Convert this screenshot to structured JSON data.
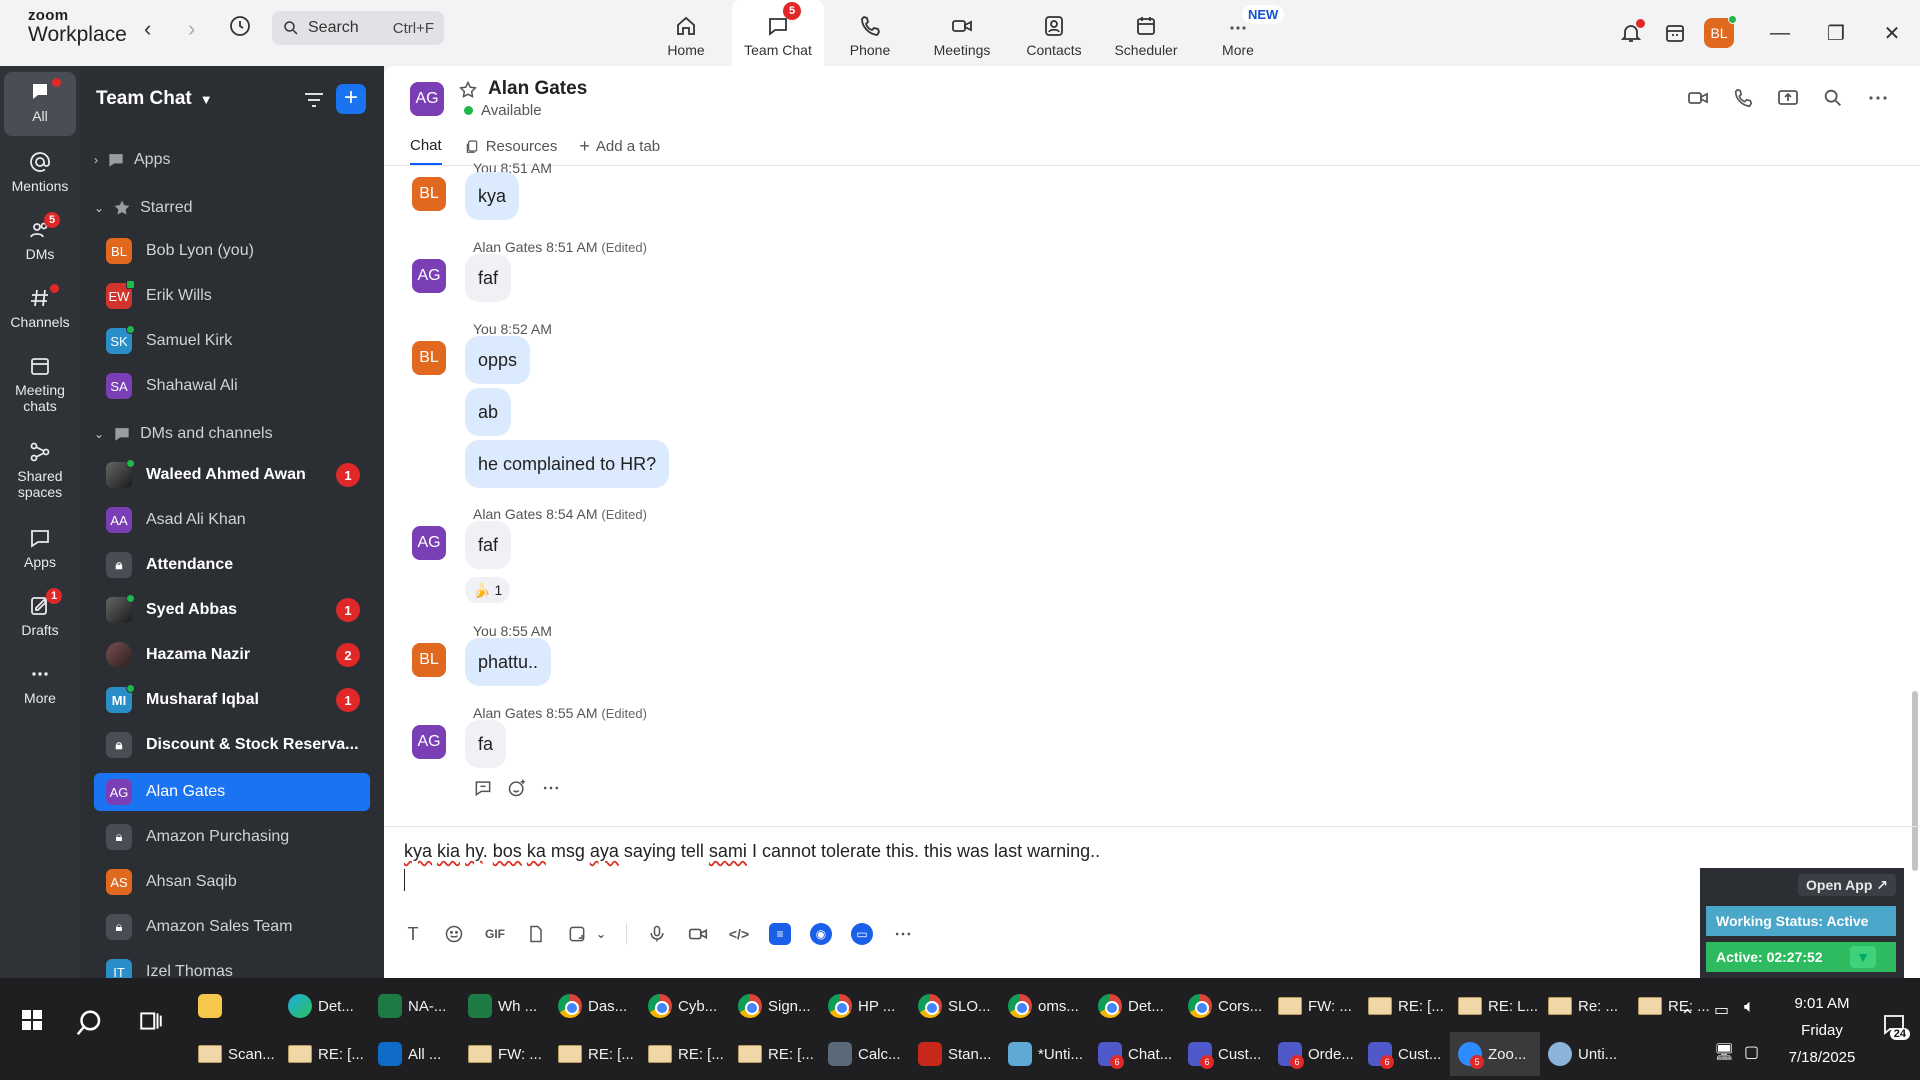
{
  "app": {
    "logo_line1": "zoom",
    "logo_line2": "Workplace",
    "search_placeholder": "Search",
    "search_shortcut": "Ctrl+F",
    "accent_color": "#0b5cff",
    "user_initials": "BL"
  },
  "topnav": {
    "items": [
      {
        "label": "Home",
        "icon": "home-icon"
      },
      {
        "label": "Team Chat",
        "icon": "chat-icon",
        "badge": "5",
        "active": true
      },
      {
        "label": "Phone",
        "icon": "phone-icon"
      },
      {
        "label": "Meetings",
        "icon": "video-icon"
      },
      {
        "label": "Contacts",
        "icon": "contacts-icon"
      },
      {
        "label": "Scheduler",
        "icon": "calendar-icon"
      },
      {
        "label": "More",
        "icon": "more-icon",
        "tag": "NEW"
      }
    ]
  },
  "rail": {
    "items": [
      {
        "label": "All"
      },
      {
        "label": "Mentions"
      },
      {
        "label": "DMs",
        "badge": "5"
      },
      {
        "label": "Channels"
      },
      {
        "label": "Meeting chats"
      },
      {
        "label": "Shared spaces"
      },
      {
        "label": "Apps"
      },
      {
        "label": "Drafts",
        "badge": "1"
      },
      {
        "label": "More"
      }
    ]
  },
  "sidebar": {
    "title": "Team Chat",
    "sections": {
      "apps": "Apps",
      "starred": "Starred",
      "dms": "DMs and channels"
    },
    "starred": [
      {
        "initials": "BL",
        "name": "Bob Lyon (you)",
        "color": "#e0691f"
      },
      {
        "initials": "EW",
        "name": "Erik Wills",
        "color": "#d0342c"
      },
      {
        "initials": "SK",
        "name": "Samuel Kirk",
        "color": "#2a8fc9"
      },
      {
        "initials": "SA",
        "name": "Shahawal Ali",
        "color": "#7b3fb5"
      }
    ],
    "channels": [
      {
        "initials": "",
        "name": "Waleed Ahmed Awan",
        "count": "1"
      },
      {
        "initials": "AA",
        "name": "Asad Ali Khan",
        "color": "#7b3fb5"
      },
      {
        "initials": "",
        "name": "Attendance"
      },
      {
        "initials": "",
        "name": "Syed Abbas",
        "count": "1"
      },
      {
        "initials": "",
        "name": "Hazama Nazir",
        "count": "2"
      },
      {
        "initials": "MI",
        "name": "Musharaf Iqbal",
        "count": "1",
        "color": "#2a8fc9"
      },
      {
        "initials": "",
        "name": "Discount & Stock Reserva..."
      },
      {
        "initials": "AG",
        "name": "Alan Gates",
        "color": "#7b3fb5"
      },
      {
        "initials": "",
        "name": "Amazon Purchasing"
      },
      {
        "initials": "AS",
        "name": "Ahsan Saqib",
        "color": "#e0691f"
      },
      {
        "initials": "",
        "name": "Amazon Sales Team"
      },
      {
        "initials": "IT",
        "name": "Izel Thomas",
        "color": "#2a8fc9"
      }
    ]
  },
  "channel": {
    "initials": "AG",
    "name": "Alan Gates",
    "status": "Available",
    "tabs": [
      "Chat",
      "Resources",
      "Add a tab"
    ]
  },
  "messages": {
    "cut_meta": "You 8:51 AM",
    "m1": "kya",
    "g2_sender": "Alan Gates",
    "g2_time": "8:51 AM",
    "edited": "(Edited)",
    "m2": "faf",
    "g3_sender": "You",
    "g3_time": "8:52 AM",
    "m3": "opps",
    "m4": "ab",
    "m5": "he complained to HR?",
    "g4_sender": "Alan Gates",
    "g4_time": "8:54 AM",
    "m6": "faf",
    "reaction_emoji": "🍌",
    "reaction_count": "1",
    "g5_sender": "You",
    "g5_time": "8:55 AM",
    "m7": "phattu..",
    "g6_sender": "Alan Gates",
    "g6_time": "8:55 AM",
    "m8": "fa"
  },
  "composer": {
    "w1": "kya",
    "w2": "kia",
    "w3": "hy",
    "w4": ". ",
    "w5": "bos",
    "w6": " ",
    "w7": "ka",
    "w8": " msg ",
    "w9": "aya",
    "w10": " saying tell ",
    "w11": "sami",
    "w12": " I cannot tolerate this. this was last warning..",
    "gif_label": "GIF"
  },
  "widget": {
    "open_app": "Open App ↗",
    "working_status": "Working Status: Active",
    "active_timer": "Active: 02:27:52"
  },
  "taskbar": {
    "row1": [
      {
        "label": "",
        "icon": "folder"
      },
      {
        "label": "Det...",
        "icon": "edge"
      },
      {
        "label": "NA-...",
        "icon": "excel"
      },
      {
        "label": "Wh ...",
        "icon": "excel"
      },
      {
        "label": "Das...",
        "icon": "chrome"
      },
      {
        "label": "Cyb...",
        "icon": "chrome"
      },
      {
        "label": "Sign...",
        "icon": "chrome"
      },
      {
        "label": "HP ...",
        "icon": "chrome"
      },
      {
        "label": "SLO...",
        "icon": "chrome"
      },
      {
        "label": "oms...",
        "icon": "chrome"
      },
      {
        "label": "Det...",
        "icon": "chrome"
      },
      {
        "label": "Cors...",
        "icon": "chrome"
      },
      {
        "label": "FW: ...",
        "icon": "mail"
      },
      {
        "label": "RE: [...",
        "icon": "mail"
      },
      {
        "label": "RE: L...",
        "icon": "mail"
      },
      {
        "label": "Re: ...",
        "icon": "mail"
      },
      {
        "label": "RE: ...",
        "icon": "mail"
      }
    ],
    "row2": [
      {
        "label": "Scan...",
        "icon": "mail"
      },
      {
        "label": "RE: [...",
        "icon": "mail"
      },
      {
        "label": "All ...",
        "icon": "outlook"
      },
      {
        "label": "FW: ...",
        "icon": "mail"
      },
      {
        "label": "RE: [...",
        "icon": "mail"
      },
      {
        "label": "RE: [...",
        "icon": "mail"
      },
      {
        "label": "RE: [...",
        "icon": "mail"
      },
      {
        "label": "Calc...",
        "icon": "calc"
      },
      {
        "label": "Stan...",
        "icon": "pdf"
      },
      {
        "label": "*Unti...",
        "icon": "notepad"
      },
      {
        "label": "Chat...",
        "icon": "teams",
        "badge": "6"
      },
      {
        "label": "Cust...",
        "icon": "teams",
        "badge": "6"
      },
      {
        "label": "Orde...",
        "icon": "teams",
        "badge": "6"
      },
      {
        "label": "Cust...",
        "icon": "teams",
        "badge": "6"
      },
      {
        "label": "Zoo...",
        "icon": "zoom",
        "badge": "5",
        "active": true
      },
      {
        "label": "Unti...",
        "icon": "paint"
      }
    ],
    "time": "9:01 AM",
    "day": "Friday",
    "date": "7/18/2025",
    "notifications": "24"
  }
}
